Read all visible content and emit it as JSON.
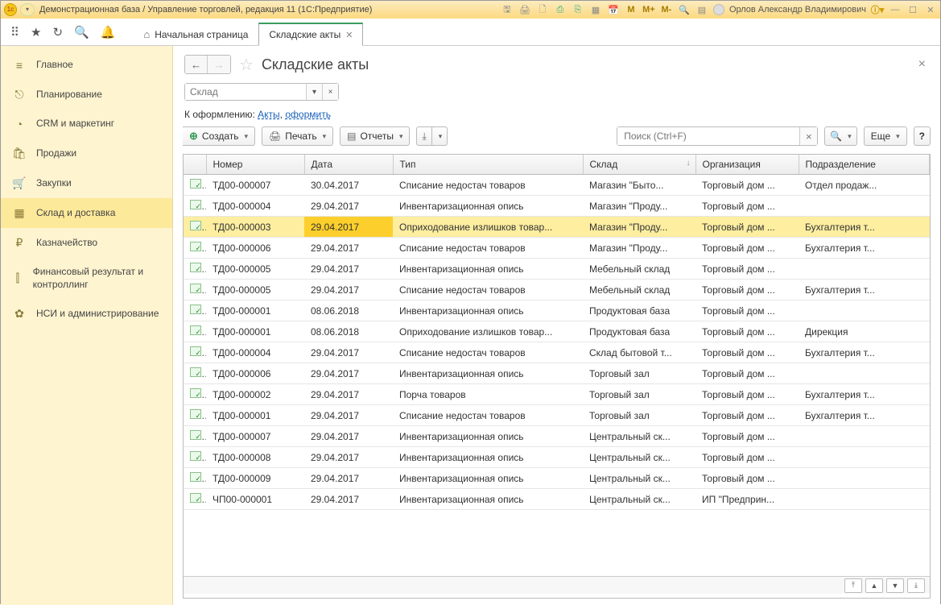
{
  "titlebar": {
    "text": "Демонстрационная база / Управление торговлей, редакция 11 (1С:Предприятие)",
    "user": "Орлов Александр Владимирович"
  },
  "mem": {
    "m": "M",
    "mp": "M+",
    "mm": "M-"
  },
  "tabs": {
    "home": "Начальная страница",
    "active": "Складские акты"
  },
  "sidebar": [
    {
      "icon": "≡",
      "label": "Главное"
    },
    {
      "icon": "⎋",
      "label": "Планирование"
    },
    {
      "icon": "◔",
      "label": "CRM и маркетинг"
    },
    {
      "icon": "🛍",
      "label": "Продажи"
    },
    {
      "icon": "🛒",
      "label": "Закупки"
    },
    {
      "icon": "▦",
      "label": "Склад и доставка",
      "sel": true
    },
    {
      "icon": "₽",
      "label": "Казначейство"
    },
    {
      "icon": "⫿",
      "label": "Финансовый результат и контроллинг"
    },
    {
      "icon": "✿",
      "label": "НСИ и администрирование"
    }
  ],
  "page": {
    "title": "Складские акты"
  },
  "filter": {
    "placeholder": "Склад"
  },
  "linkrow": {
    "prefix": "К оформлению: ",
    "a1": "Акты",
    "sep": ", ",
    "a2": "оформить"
  },
  "toolbar": {
    "create": "Создать",
    "print": "Печать",
    "reports": "Отчеты",
    "more": "Еще",
    "searchPH": "Поиск (Ctrl+F)"
  },
  "columns": {
    "num": "Номер",
    "date": "Дата",
    "type": "Тип",
    "wh": "Склад",
    "org": "Организация",
    "dep": "Подразделение"
  },
  "rows": [
    {
      "n": "ТД00-000007",
      "d": "30.04.2017",
      "t": "Списание недостач товаров",
      "w": "Магазин \"Быто...",
      "o": "Торговый дом ...",
      "p": "Отдел продаж..."
    },
    {
      "n": "ТД00-000004",
      "d": "29.04.2017",
      "t": "Инвентаризационная опись",
      "w": "Магазин \"Проду...",
      "o": "Торговый дом ...",
      "p": ""
    },
    {
      "n": "ТД00-000003",
      "d": "29.04.2017",
      "t": "Оприходование излишков товар...",
      "w": "Магазин \"Проду...",
      "o": "Торговый дом ...",
      "p": "Бухгалтерия т...",
      "sel": true
    },
    {
      "n": "ТД00-000006",
      "d": "29.04.2017",
      "t": "Списание недостач товаров",
      "w": "Магазин \"Проду...",
      "o": "Торговый дом ...",
      "p": "Бухгалтерия т..."
    },
    {
      "n": "ТД00-000005",
      "d": "29.04.2017",
      "t": "Инвентаризационная опись",
      "w": "Мебельный склад",
      "o": "Торговый дом ...",
      "p": ""
    },
    {
      "n": "ТД00-000005",
      "d": "29.04.2017",
      "t": "Списание недостач товаров",
      "w": "Мебельный склад",
      "o": "Торговый дом ...",
      "p": "Бухгалтерия т..."
    },
    {
      "n": "ТД00-000001",
      "d": "08.06.2018",
      "t": "Инвентаризационная опись",
      "w": "Продуктовая база",
      "o": "Торговый дом ...",
      "p": ""
    },
    {
      "n": "ТД00-000001",
      "d": "08.06.2018",
      "t": "Оприходование излишков товар...",
      "w": "Продуктовая база",
      "o": "Торговый дом ...",
      "p": "Дирекция"
    },
    {
      "n": "ТД00-000004",
      "d": "29.04.2017",
      "t": "Списание недостач товаров",
      "w": "Склад бытовой т...",
      "o": "Торговый дом ...",
      "p": "Бухгалтерия т..."
    },
    {
      "n": "ТД00-000006",
      "d": "29.04.2017",
      "t": "Инвентаризационная опись",
      "w": "Торговый зал",
      "o": "Торговый дом ...",
      "p": ""
    },
    {
      "n": "ТД00-000002",
      "d": "29.04.2017",
      "t": "Порча товаров",
      "w": "Торговый зал",
      "o": "Торговый дом ...",
      "p": "Бухгалтерия т..."
    },
    {
      "n": "ТД00-000001",
      "d": "29.04.2017",
      "t": "Списание недостач товаров",
      "w": "Торговый зал",
      "o": "Торговый дом ...",
      "p": "Бухгалтерия т..."
    },
    {
      "n": "ТД00-000007",
      "d": "29.04.2017",
      "t": "Инвентаризационная опись",
      "w": "Центральный ск...",
      "o": "Торговый дом ...",
      "p": ""
    },
    {
      "n": "ТД00-000008",
      "d": "29.04.2017",
      "t": "Инвентаризационная опись",
      "w": "Центральный ск...",
      "o": "Торговый дом ...",
      "p": ""
    },
    {
      "n": "ТД00-000009",
      "d": "29.04.2017",
      "t": "Инвентаризационная опись",
      "w": "Центральный ск...",
      "o": "Торговый дом ...",
      "p": ""
    },
    {
      "n": "ЧП00-000001",
      "d": "29.04.2017",
      "t": "Инвентаризационная опись",
      "w": "Центральный ск...",
      "o": "ИП \"Предприн...",
      "p": ""
    }
  ]
}
